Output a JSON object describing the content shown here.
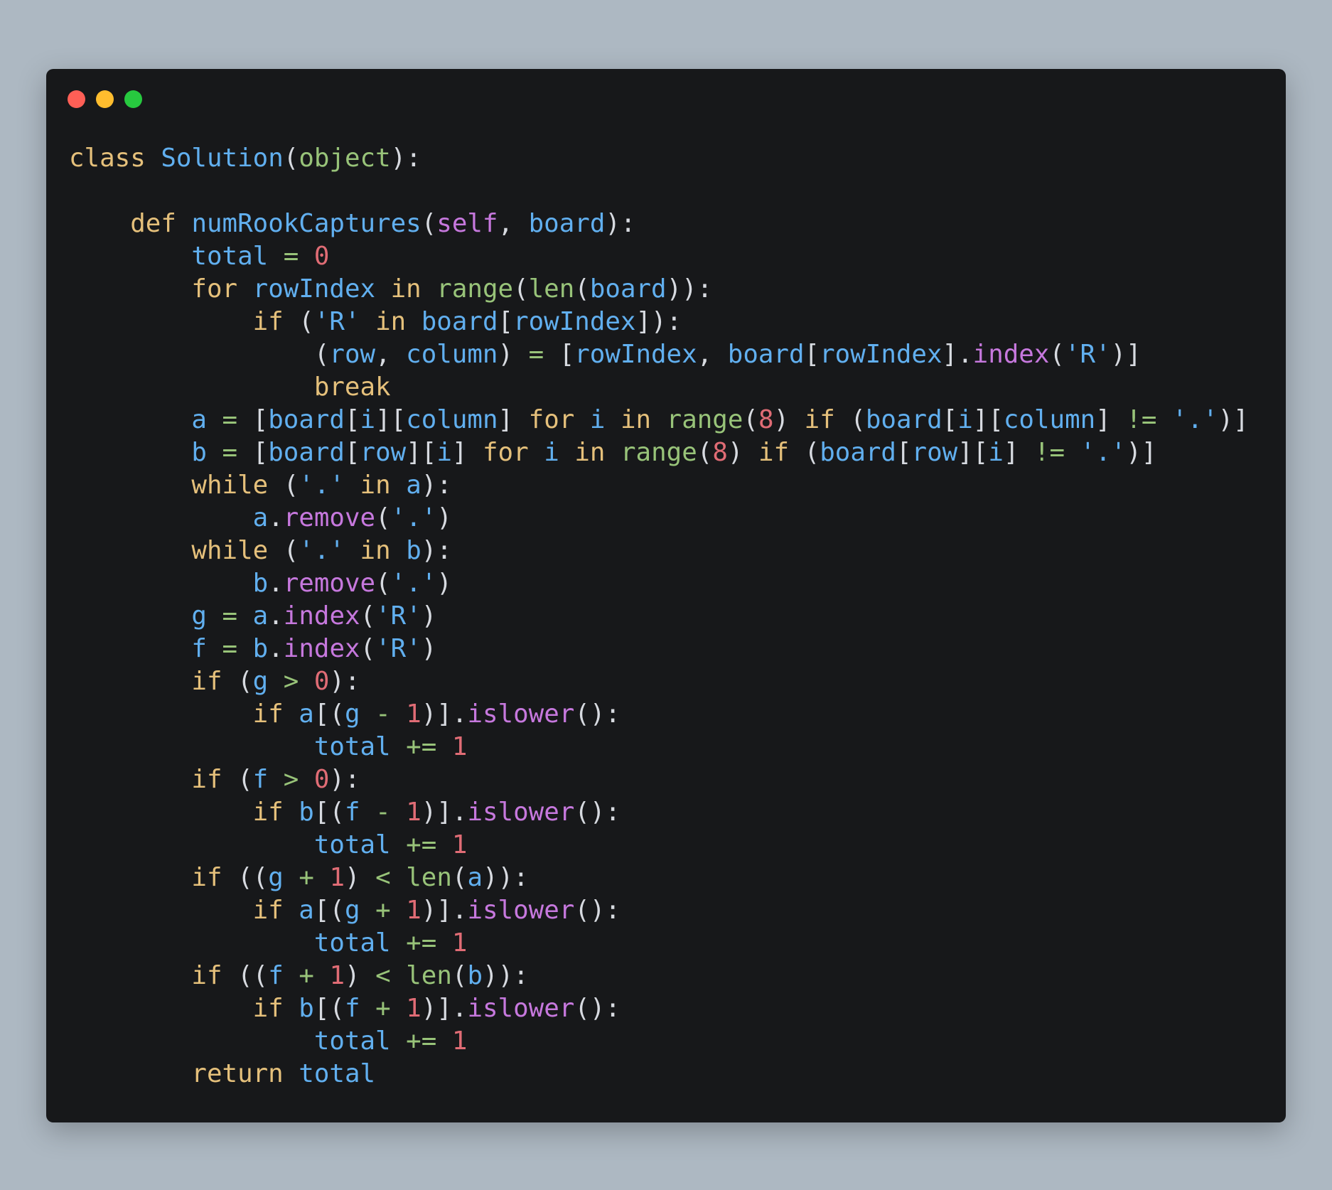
{
  "window": {
    "traffic_lights": [
      {
        "name": "close",
        "color": "#ff5f56"
      },
      {
        "name": "minimize",
        "color": "#ffbd2e"
      },
      {
        "name": "maximize",
        "color": "#27c93f"
      }
    ]
  },
  "colors": {
    "background": "#adb8c2",
    "window": "#17181a",
    "keyword": "#e5c07b",
    "identifier": "#61afef",
    "string": "#61afef",
    "number": "#e06c75",
    "builtin": "#98c379",
    "method": "#c678dd",
    "operator": "#98c379",
    "punctuation": "#d7dae0"
  },
  "code": {
    "language": "python",
    "lines": [
      [
        {
          "t": "class",
          "c": "keyword"
        },
        {
          "t": " "
        },
        {
          "t": "Solution",
          "c": "identifier"
        },
        {
          "t": "("
        },
        {
          "t": "object",
          "c": "builtin"
        },
        {
          "t": "):"
        }
      ],
      [],
      [
        {
          "t": "    "
        },
        {
          "t": "def",
          "c": "keyword"
        },
        {
          "t": " "
        },
        {
          "t": "numRookCaptures",
          "c": "identifier"
        },
        {
          "t": "("
        },
        {
          "t": "self",
          "c": "method"
        },
        {
          "t": ", "
        },
        {
          "t": "board",
          "c": "identifier"
        },
        {
          "t": "):"
        }
      ],
      [
        {
          "t": "        "
        },
        {
          "t": "total",
          "c": "identifier"
        },
        {
          "t": " "
        },
        {
          "t": "=",
          "c": "operator"
        },
        {
          "t": " "
        },
        {
          "t": "0",
          "c": "number"
        }
      ],
      [
        {
          "t": "        "
        },
        {
          "t": "for",
          "c": "keyword"
        },
        {
          "t": " "
        },
        {
          "t": "rowIndex",
          "c": "identifier"
        },
        {
          "t": " "
        },
        {
          "t": "in",
          "c": "keyword"
        },
        {
          "t": " "
        },
        {
          "t": "range",
          "c": "builtin"
        },
        {
          "t": "("
        },
        {
          "t": "len",
          "c": "builtin"
        },
        {
          "t": "("
        },
        {
          "t": "board",
          "c": "identifier"
        },
        {
          "t": ")):"
        }
      ],
      [
        {
          "t": "            "
        },
        {
          "t": "if",
          "c": "keyword"
        },
        {
          "t": " ("
        },
        {
          "t": "'R'",
          "c": "string"
        },
        {
          "t": " "
        },
        {
          "t": "in",
          "c": "keyword"
        },
        {
          "t": " "
        },
        {
          "t": "board",
          "c": "identifier"
        },
        {
          "t": "["
        },
        {
          "t": "rowIndex",
          "c": "identifier"
        },
        {
          "t": "]):"
        }
      ],
      [
        {
          "t": "                ("
        },
        {
          "t": "row",
          "c": "identifier"
        },
        {
          "t": ", "
        },
        {
          "t": "column",
          "c": "identifier"
        },
        {
          "t": ") "
        },
        {
          "t": "=",
          "c": "operator"
        },
        {
          "t": " ["
        },
        {
          "t": "rowIndex",
          "c": "identifier"
        },
        {
          "t": ", "
        },
        {
          "t": "board",
          "c": "identifier"
        },
        {
          "t": "["
        },
        {
          "t": "rowIndex",
          "c": "identifier"
        },
        {
          "t": "]."
        },
        {
          "t": "index",
          "c": "method"
        },
        {
          "t": "("
        },
        {
          "t": "'R'",
          "c": "string"
        },
        {
          "t": ")]"
        }
      ],
      [
        {
          "t": "                "
        },
        {
          "t": "break",
          "c": "keyword"
        }
      ],
      [
        {
          "t": "        "
        },
        {
          "t": "a",
          "c": "identifier"
        },
        {
          "t": " "
        },
        {
          "t": "=",
          "c": "operator"
        },
        {
          "t": " ["
        },
        {
          "t": "board",
          "c": "identifier"
        },
        {
          "t": "["
        },
        {
          "t": "i",
          "c": "identifier"
        },
        {
          "t": "]["
        },
        {
          "t": "column",
          "c": "identifier"
        },
        {
          "t": "] "
        },
        {
          "t": "for",
          "c": "keyword"
        },
        {
          "t": " "
        },
        {
          "t": "i",
          "c": "identifier"
        },
        {
          "t": " "
        },
        {
          "t": "in",
          "c": "keyword"
        },
        {
          "t": " "
        },
        {
          "t": "range",
          "c": "builtin"
        },
        {
          "t": "("
        },
        {
          "t": "8",
          "c": "number"
        },
        {
          "t": ") "
        },
        {
          "t": "if",
          "c": "keyword"
        },
        {
          "t": " ("
        },
        {
          "t": "board",
          "c": "identifier"
        },
        {
          "t": "["
        },
        {
          "t": "i",
          "c": "identifier"
        },
        {
          "t": "]["
        },
        {
          "t": "column",
          "c": "identifier"
        },
        {
          "t": "] "
        },
        {
          "t": "!=",
          "c": "operator"
        },
        {
          "t": " "
        },
        {
          "t": "'.'",
          "c": "string"
        },
        {
          "t": ")]"
        }
      ],
      [
        {
          "t": "        "
        },
        {
          "t": "b",
          "c": "identifier"
        },
        {
          "t": " "
        },
        {
          "t": "=",
          "c": "operator"
        },
        {
          "t": " ["
        },
        {
          "t": "board",
          "c": "identifier"
        },
        {
          "t": "["
        },
        {
          "t": "row",
          "c": "identifier"
        },
        {
          "t": "]["
        },
        {
          "t": "i",
          "c": "identifier"
        },
        {
          "t": "] "
        },
        {
          "t": "for",
          "c": "keyword"
        },
        {
          "t": " "
        },
        {
          "t": "i",
          "c": "identifier"
        },
        {
          "t": " "
        },
        {
          "t": "in",
          "c": "keyword"
        },
        {
          "t": " "
        },
        {
          "t": "range",
          "c": "builtin"
        },
        {
          "t": "("
        },
        {
          "t": "8",
          "c": "number"
        },
        {
          "t": ") "
        },
        {
          "t": "if",
          "c": "keyword"
        },
        {
          "t": " ("
        },
        {
          "t": "board",
          "c": "identifier"
        },
        {
          "t": "["
        },
        {
          "t": "row",
          "c": "identifier"
        },
        {
          "t": "]["
        },
        {
          "t": "i",
          "c": "identifier"
        },
        {
          "t": "] "
        },
        {
          "t": "!=",
          "c": "operator"
        },
        {
          "t": " "
        },
        {
          "t": "'.'",
          "c": "string"
        },
        {
          "t": ")]"
        }
      ],
      [
        {
          "t": "        "
        },
        {
          "t": "while",
          "c": "keyword"
        },
        {
          "t": " ("
        },
        {
          "t": "'.'",
          "c": "string"
        },
        {
          "t": " "
        },
        {
          "t": "in",
          "c": "keyword"
        },
        {
          "t": " "
        },
        {
          "t": "a",
          "c": "identifier"
        },
        {
          "t": "):"
        }
      ],
      [
        {
          "t": "            "
        },
        {
          "t": "a",
          "c": "identifier"
        },
        {
          "t": "."
        },
        {
          "t": "remove",
          "c": "method"
        },
        {
          "t": "("
        },
        {
          "t": "'.'",
          "c": "string"
        },
        {
          "t": ")"
        }
      ],
      [
        {
          "t": "        "
        },
        {
          "t": "while",
          "c": "keyword"
        },
        {
          "t": " ("
        },
        {
          "t": "'.'",
          "c": "string"
        },
        {
          "t": " "
        },
        {
          "t": "in",
          "c": "keyword"
        },
        {
          "t": " "
        },
        {
          "t": "b",
          "c": "identifier"
        },
        {
          "t": "):"
        }
      ],
      [
        {
          "t": "            "
        },
        {
          "t": "b",
          "c": "identifier"
        },
        {
          "t": "."
        },
        {
          "t": "remove",
          "c": "method"
        },
        {
          "t": "("
        },
        {
          "t": "'.'",
          "c": "string"
        },
        {
          "t": ")"
        }
      ],
      [
        {
          "t": "        "
        },
        {
          "t": "g",
          "c": "identifier"
        },
        {
          "t": " "
        },
        {
          "t": "=",
          "c": "operator"
        },
        {
          "t": " "
        },
        {
          "t": "a",
          "c": "identifier"
        },
        {
          "t": "."
        },
        {
          "t": "index",
          "c": "method"
        },
        {
          "t": "("
        },
        {
          "t": "'R'",
          "c": "string"
        },
        {
          "t": ")"
        }
      ],
      [
        {
          "t": "        "
        },
        {
          "t": "f",
          "c": "identifier"
        },
        {
          "t": " "
        },
        {
          "t": "=",
          "c": "operator"
        },
        {
          "t": " "
        },
        {
          "t": "b",
          "c": "identifier"
        },
        {
          "t": "."
        },
        {
          "t": "index",
          "c": "method"
        },
        {
          "t": "("
        },
        {
          "t": "'R'",
          "c": "string"
        },
        {
          "t": ")"
        }
      ],
      [
        {
          "t": "        "
        },
        {
          "t": "if",
          "c": "keyword"
        },
        {
          "t": " ("
        },
        {
          "t": "g",
          "c": "identifier"
        },
        {
          "t": " "
        },
        {
          "t": ">",
          "c": "operator"
        },
        {
          "t": " "
        },
        {
          "t": "0",
          "c": "number"
        },
        {
          "t": "):"
        }
      ],
      [
        {
          "t": "            "
        },
        {
          "t": "if",
          "c": "keyword"
        },
        {
          "t": " "
        },
        {
          "t": "a",
          "c": "identifier"
        },
        {
          "t": "[("
        },
        {
          "t": "g",
          "c": "identifier"
        },
        {
          "t": " "
        },
        {
          "t": "-",
          "c": "operator"
        },
        {
          "t": " "
        },
        {
          "t": "1",
          "c": "number"
        },
        {
          "t": ")]."
        },
        {
          "t": "islower",
          "c": "method"
        },
        {
          "t": "():"
        }
      ],
      [
        {
          "t": "                "
        },
        {
          "t": "total",
          "c": "identifier"
        },
        {
          "t": " "
        },
        {
          "t": "+=",
          "c": "operator"
        },
        {
          "t": " "
        },
        {
          "t": "1",
          "c": "number"
        }
      ],
      [
        {
          "t": "        "
        },
        {
          "t": "if",
          "c": "keyword"
        },
        {
          "t": " ("
        },
        {
          "t": "f",
          "c": "identifier"
        },
        {
          "t": " "
        },
        {
          "t": ">",
          "c": "operator"
        },
        {
          "t": " "
        },
        {
          "t": "0",
          "c": "number"
        },
        {
          "t": "):"
        }
      ],
      [
        {
          "t": "            "
        },
        {
          "t": "if",
          "c": "keyword"
        },
        {
          "t": " "
        },
        {
          "t": "b",
          "c": "identifier"
        },
        {
          "t": "[("
        },
        {
          "t": "f",
          "c": "identifier"
        },
        {
          "t": " "
        },
        {
          "t": "-",
          "c": "operator"
        },
        {
          "t": " "
        },
        {
          "t": "1",
          "c": "number"
        },
        {
          "t": ")]."
        },
        {
          "t": "islower",
          "c": "method"
        },
        {
          "t": "():"
        }
      ],
      [
        {
          "t": "                "
        },
        {
          "t": "total",
          "c": "identifier"
        },
        {
          "t": " "
        },
        {
          "t": "+=",
          "c": "operator"
        },
        {
          "t": " "
        },
        {
          "t": "1",
          "c": "number"
        }
      ],
      [
        {
          "t": "        "
        },
        {
          "t": "if",
          "c": "keyword"
        },
        {
          "t": " (("
        },
        {
          "t": "g",
          "c": "identifier"
        },
        {
          "t": " "
        },
        {
          "t": "+",
          "c": "operator"
        },
        {
          "t": " "
        },
        {
          "t": "1",
          "c": "number"
        },
        {
          "t": ") "
        },
        {
          "t": "<",
          "c": "operator"
        },
        {
          "t": " "
        },
        {
          "t": "len",
          "c": "builtin"
        },
        {
          "t": "("
        },
        {
          "t": "a",
          "c": "identifier"
        },
        {
          "t": ")):"
        }
      ],
      [
        {
          "t": "            "
        },
        {
          "t": "if",
          "c": "keyword"
        },
        {
          "t": " "
        },
        {
          "t": "a",
          "c": "identifier"
        },
        {
          "t": "[("
        },
        {
          "t": "g",
          "c": "identifier"
        },
        {
          "t": " "
        },
        {
          "t": "+",
          "c": "operator"
        },
        {
          "t": " "
        },
        {
          "t": "1",
          "c": "number"
        },
        {
          "t": ")]."
        },
        {
          "t": "islower",
          "c": "method"
        },
        {
          "t": "():"
        }
      ],
      [
        {
          "t": "                "
        },
        {
          "t": "total",
          "c": "identifier"
        },
        {
          "t": " "
        },
        {
          "t": "+=",
          "c": "operator"
        },
        {
          "t": " "
        },
        {
          "t": "1",
          "c": "number"
        }
      ],
      [
        {
          "t": "        "
        },
        {
          "t": "if",
          "c": "keyword"
        },
        {
          "t": " (("
        },
        {
          "t": "f",
          "c": "identifier"
        },
        {
          "t": " "
        },
        {
          "t": "+",
          "c": "operator"
        },
        {
          "t": " "
        },
        {
          "t": "1",
          "c": "number"
        },
        {
          "t": ") "
        },
        {
          "t": "<",
          "c": "operator"
        },
        {
          "t": " "
        },
        {
          "t": "len",
          "c": "builtin"
        },
        {
          "t": "("
        },
        {
          "t": "b",
          "c": "identifier"
        },
        {
          "t": ")):"
        }
      ],
      [
        {
          "t": "            "
        },
        {
          "t": "if",
          "c": "keyword"
        },
        {
          "t": " "
        },
        {
          "t": "b",
          "c": "identifier"
        },
        {
          "t": "[("
        },
        {
          "t": "f",
          "c": "identifier"
        },
        {
          "t": " "
        },
        {
          "t": "+",
          "c": "operator"
        },
        {
          "t": " "
        },
        {
          "t": "1",
          "c": "number"
        },
        {
          "t": ")]."
        },
        {
          "t": "islower",
          "c": "method"
        },
        {
          "t": "():"
        }
      ],
      [
        {
          "t": "                "
        },
        {
          "t": "total",
          "c": "identifier"
        },
        {
          "t": " "
        },
        {
          "t": "+=",
          "c": "operator"
        },
        {
          "t": " "
        },
        {
          "t": "1",
          "c": "number"
        }
      ],
      [
        {
          "t": "        "
        },
        {
          "t": "return",
          "c": "keyword"
        },
        {
          "t": " "
        },
        {
          "t": "total",
          "c": "identifier"
        }
      ]
    ]
  }
}
